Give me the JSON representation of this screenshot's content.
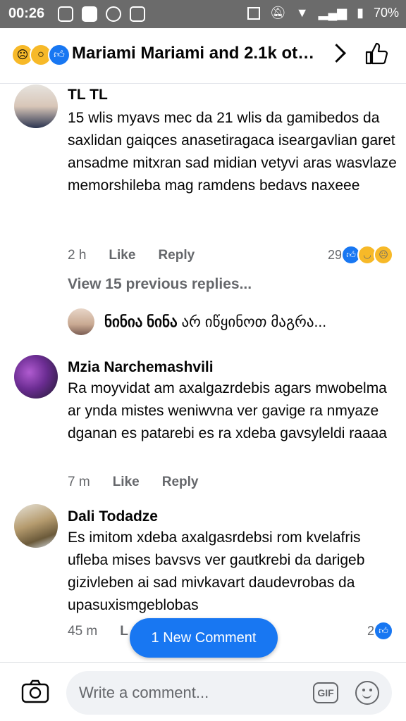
{
  "status_bar": {
    "time": "00:26",
    "battery": "70%"
  },
  "header": {
    "title": "Mariami Mariami and 2.1k ot…"
  },
  "comments": [
    {
      "name": "TL TL",
      "text": "15 wlis myavs mec da 21 wlis da gamibedos da saxlidan gaiqces anasetiragaca iseargavlian garet ansadme mitxran sad midian vetyvi aras wasvlaze memorshileba mag ramdens bedavs naxeee",
      "time": "2 h",
      "like": "Like",
      "reply": "Reply",
      "reaction_count": "29"
    },
    {
      "name": "Mzia Narchemashvili",
      "text": "Ra moyvidat am axalgazrdebis agars mwobelma ar ynda mistes weniwvna ver gavige ra nmyaze dganan es patarebi es ra xdeba gavsyleldi raaaa",
      "time": "7 m",
      "like": "Like",
      "reply": "Reply"
    },
    {
      "name": "Dali Todadze",
      "text": "Es imitom xdeba axalgasrdebsi rom kvelafris ufleba mises bavsvs ver gautkrebi da darigeb gizivleben ai sad mivkavart daudevrobas da upasuxismgeblobas",
      "time": "45 m",
      "like": "L",
      "reaction_count": "2"
    }
  ],
  "view_previous": "View 15 previous replies...",
  "reply_preview": {
    "name": "ნინია ნინა",
    "text": "არ იწყინოთ მაგრა..."
  },
  "new_comment_pill": "1 New Comment",
  "composer": {
    "placeholder": "Write a comment...",
    "gif": "GIF"
  },
  "colors": {
    "accent": "#1877f2",
    "secondary_text": "#65676b",
    "status_bar": "#6b6b6b"
  }
}
